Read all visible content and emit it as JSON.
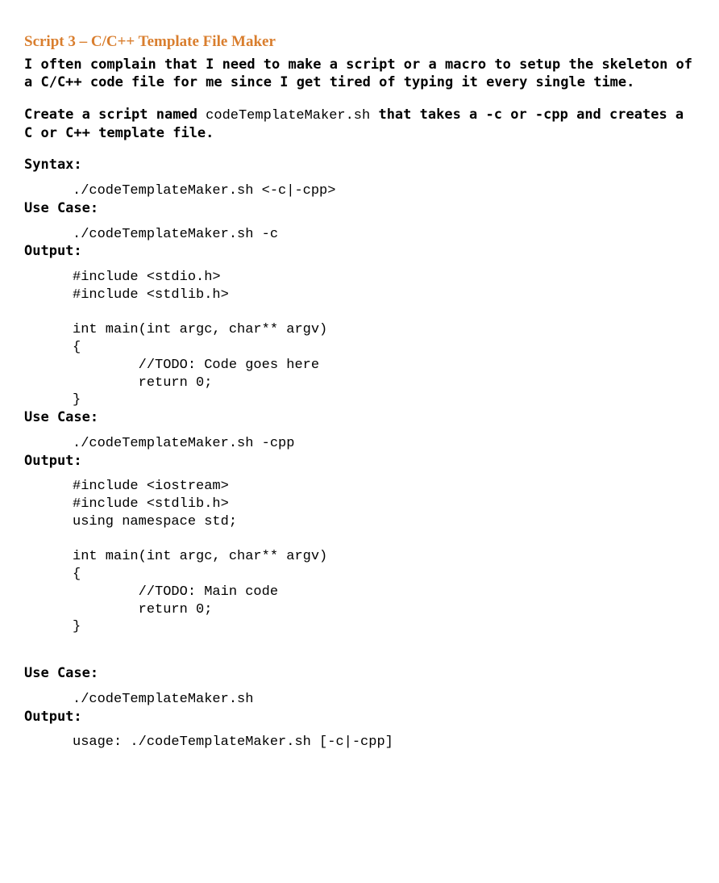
{
  "heading": {
    "text": "Script 3 – C/C++ Template File Maker",
    "color": "#D97E2E"
  },
  "intro": "I often complain that I need to make a script or a macro to setup the skeleton of a C/C++ code file for me since I get tired of typing it every single time.",
  "create_pre": "Create a script named ",
  "create_code": "codeTemplateMaker.sh",
  "create_post": " that takes a -c or -cpp and creates a C or C++ template file.",
  "labels": {
    "syntax": "Syntax:",
    "usecase": "Use Case:",
    "output": "Output:"
  },
  "syntax_cmd": "./codeTemplateMaker.sh <-c|-cpp>",
  "case1_cmd": "./codeTemplateMaker.sh -c",
  "case1_out": "#include <stdio.h>\n#include <stdlib.h>\n\nint main(int argc, char** argv)\n{\n        //TODO: Code goes here\n        return 0;\n}",
  "case2_cmd": "./codeTemplateMaker.sh -cpp",
  "case2_out": "#include <iostream>\n#include <stdlib.h>\nusing namespace std;\n\nint main(int argc, char** argv)\n{\n        //TODO: Main code\n        return 0;\n}",
  "case3_cmd": "./codeTemplateMaker.sh",
  "case3_out": "usage: ./codeTemplateMaker.sh [-c|-cpp]"
}
